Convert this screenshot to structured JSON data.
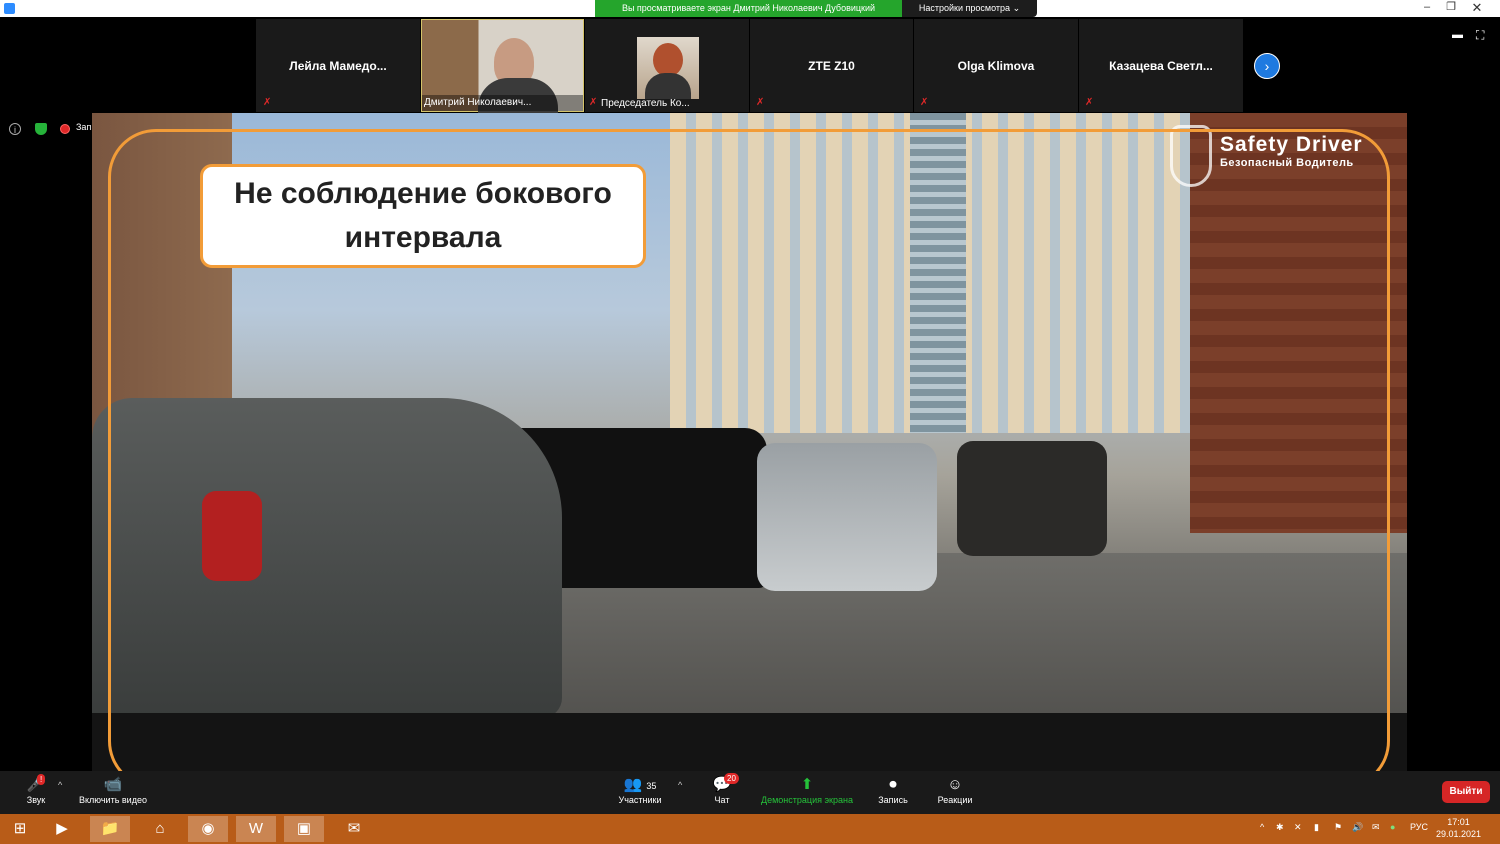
{
  "title_bar": {
    "share_banner": "Вы просматриваете экран Дмитрий Николаевич Дубовицкий",
    "view_options": "Настройки просмотра",
    "view_options_icon": "chevron-down-icon"
  },
  "participants": [
    {
      "name": "Лейла  Мамедо...",
      "muted": true
    },
    {
      "name": "Дмитрий Николаевич...",
      "muted": false,
      "video": true
    },
    {
      "name": "Председатель Ко...",
      "muted": true,
      "video": true
    },
    {
      "name": "ZTE Z10",
      "muted": true
    },
    {
      "name": "Olga Klimova",
      "muted": true
    },
    {
      "name": "Казацева  Светл...",
      "muted": true
    }
  ],
  "status": {
    "recording_label": "Запись"
  },
  "slide": {
    "caption_line1": "Не соблюдение бокового",
    "caption_line2": "интервала",
    "brand_title": "Safety Driver",
    "brand_subtitle": "Безопасный Водитель"
  },
  "toolbar": {
    "audio_label": "Звук",
    "video_label": "Включить видео",
    "participants_label": "Участники",
    "participants_count": "35",
    "chat_label": "Чат",
    "chat_badge": "20",
    "share_label": "Демонстрация экрана",
    "record_label": "Запись",
    "reactions_label": "Реакции",
    "exit_label": "Выйти",
    "audio_badge": "!"
  },
  "taskbar": {
    "language": "РУС",
    "time": "17:01",
    "date": "29.01.2021"
  },
  "colors": {
    "share_green": "#25a52c",
    "accent_orange": "#f29c38",
    "exit_red": "#d62626",
    "taskbar": "#b85c18"
  }
}
